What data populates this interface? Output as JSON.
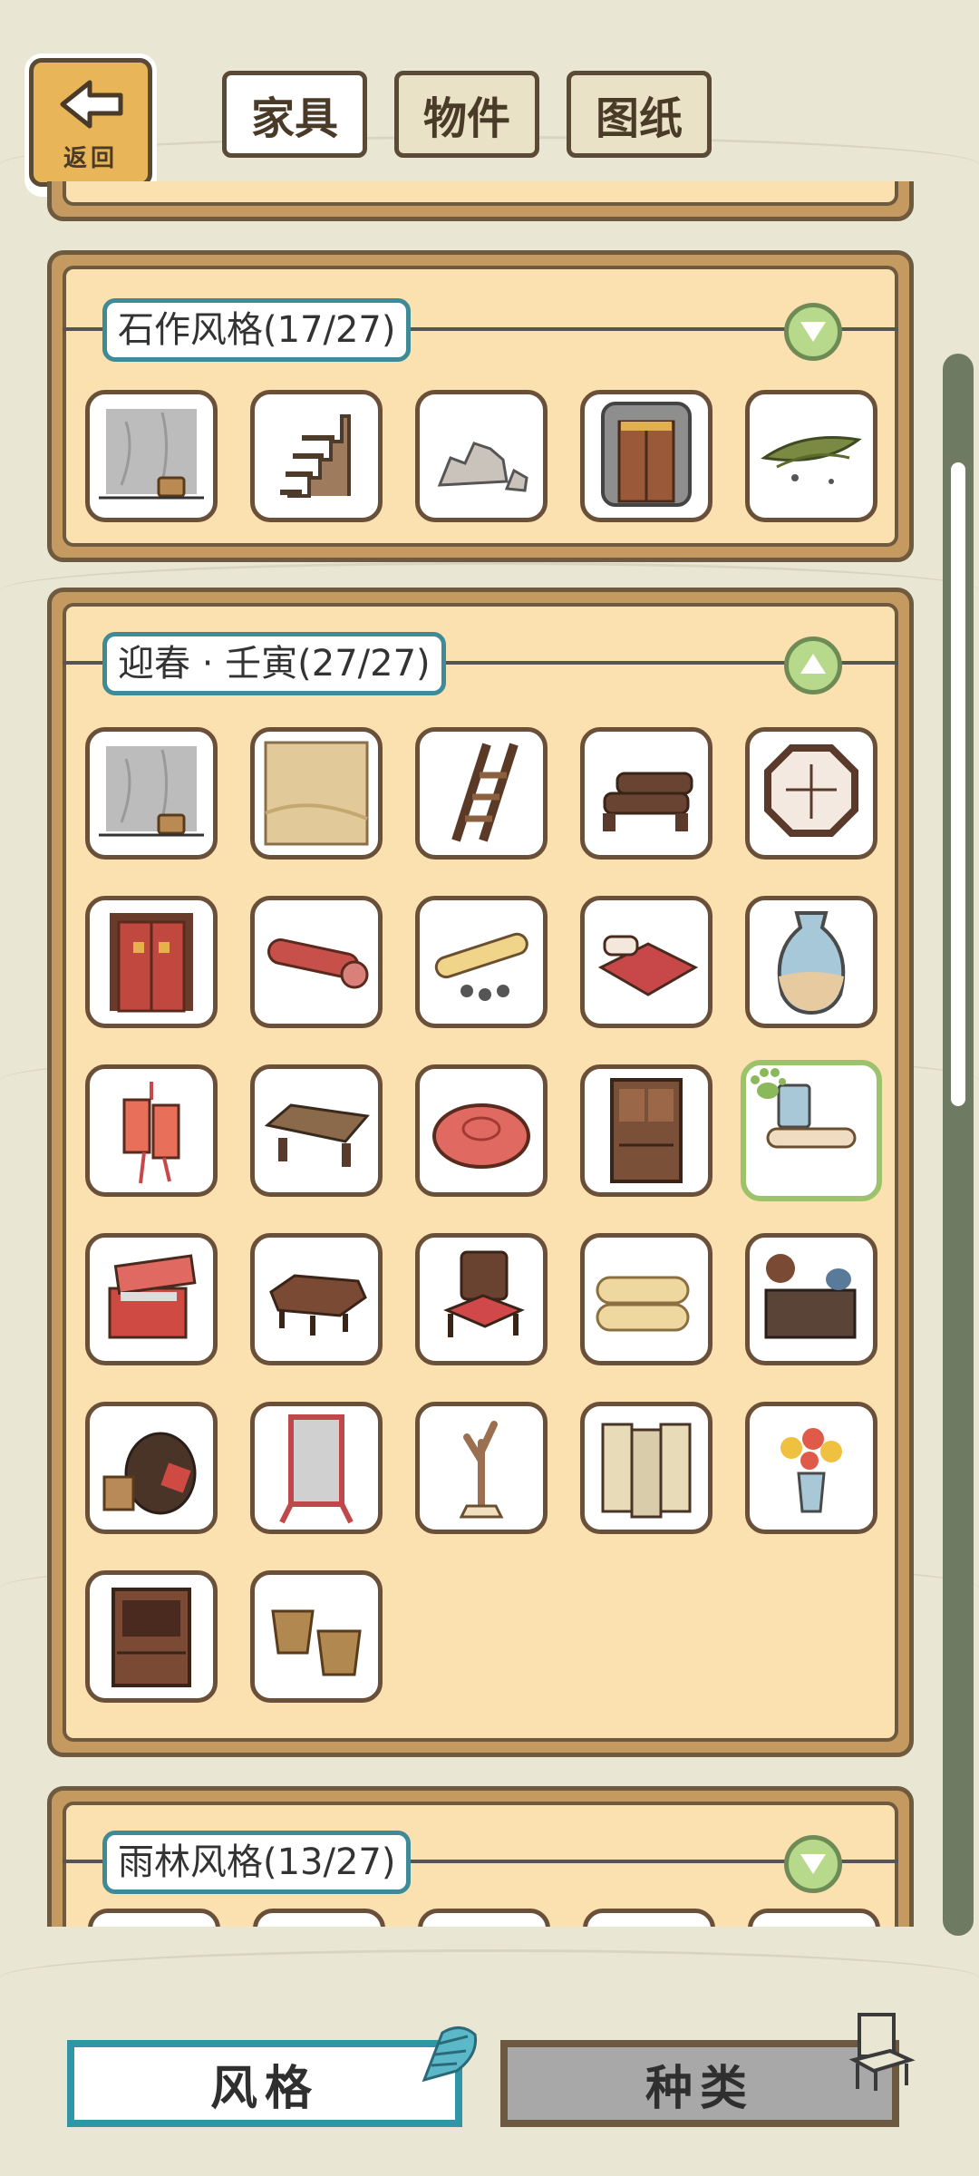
{
  "header": {
    "back_label": "返回",
    "tabs": [
      {
        "label": "家具",
        "active": true
      },
      {
        "label": "物件",
        "active": false
      },
      {
        "label": "图纸",
        "active": false
      }
    ]
  },
  "sections": [
    {
      "title": "石作风格(17/27)",
      "expanded": false
    },
    {
      "title": "迎春 · 壬寅(27/27)",
      "expanded": true
    },
    {
      "title": "雨林风格(13/27)",
      "expanded": false
    }
  ],
  "section1_items": [
    "stone-wall-icon",
    "stone-stairs-icon",
    "rocks-icon",
    "stone-door-icon",
    "leaves-icon"
  ],
  "section2_items": [
    "stone-wall-icon",
    "sand-floor-icon",
    "ladder-icon",
    "log-bench-icon",
    "octagon-window-icon",
    "red-door-icon",
    "red-scroll-icon",
    "paper-scroll-icon",
    "red-bed-icon",
    "vase-icon",
    "charm-icon",
    "low-table-icon",
    "cushion-icon",
    "cabinet-icon",
    "cup-scroll-icon",
    "red-chest-icon",
    "red-table-icon",
    "red-chair-icon",
    "rolled-mat-icon",
    "tea-set-icon",
    "wine-jar-icon",
    "mirror-icon",
    "branch-stand-icon",
    "folding-screen-icon",
    "flower-vase-icon",
    "shelf-icon",
    "basket-icon"
  ],
  "bottom": {
    "style_label": "风格",
    "type_label": "种类",
    "active": "style"
  },
  "colors": {
    "accent": "#2f96a8",
    "panel": "#fbe0b0",
    "frame": "#c59a61",
    "selected": "#9cc26c"
  }
}
